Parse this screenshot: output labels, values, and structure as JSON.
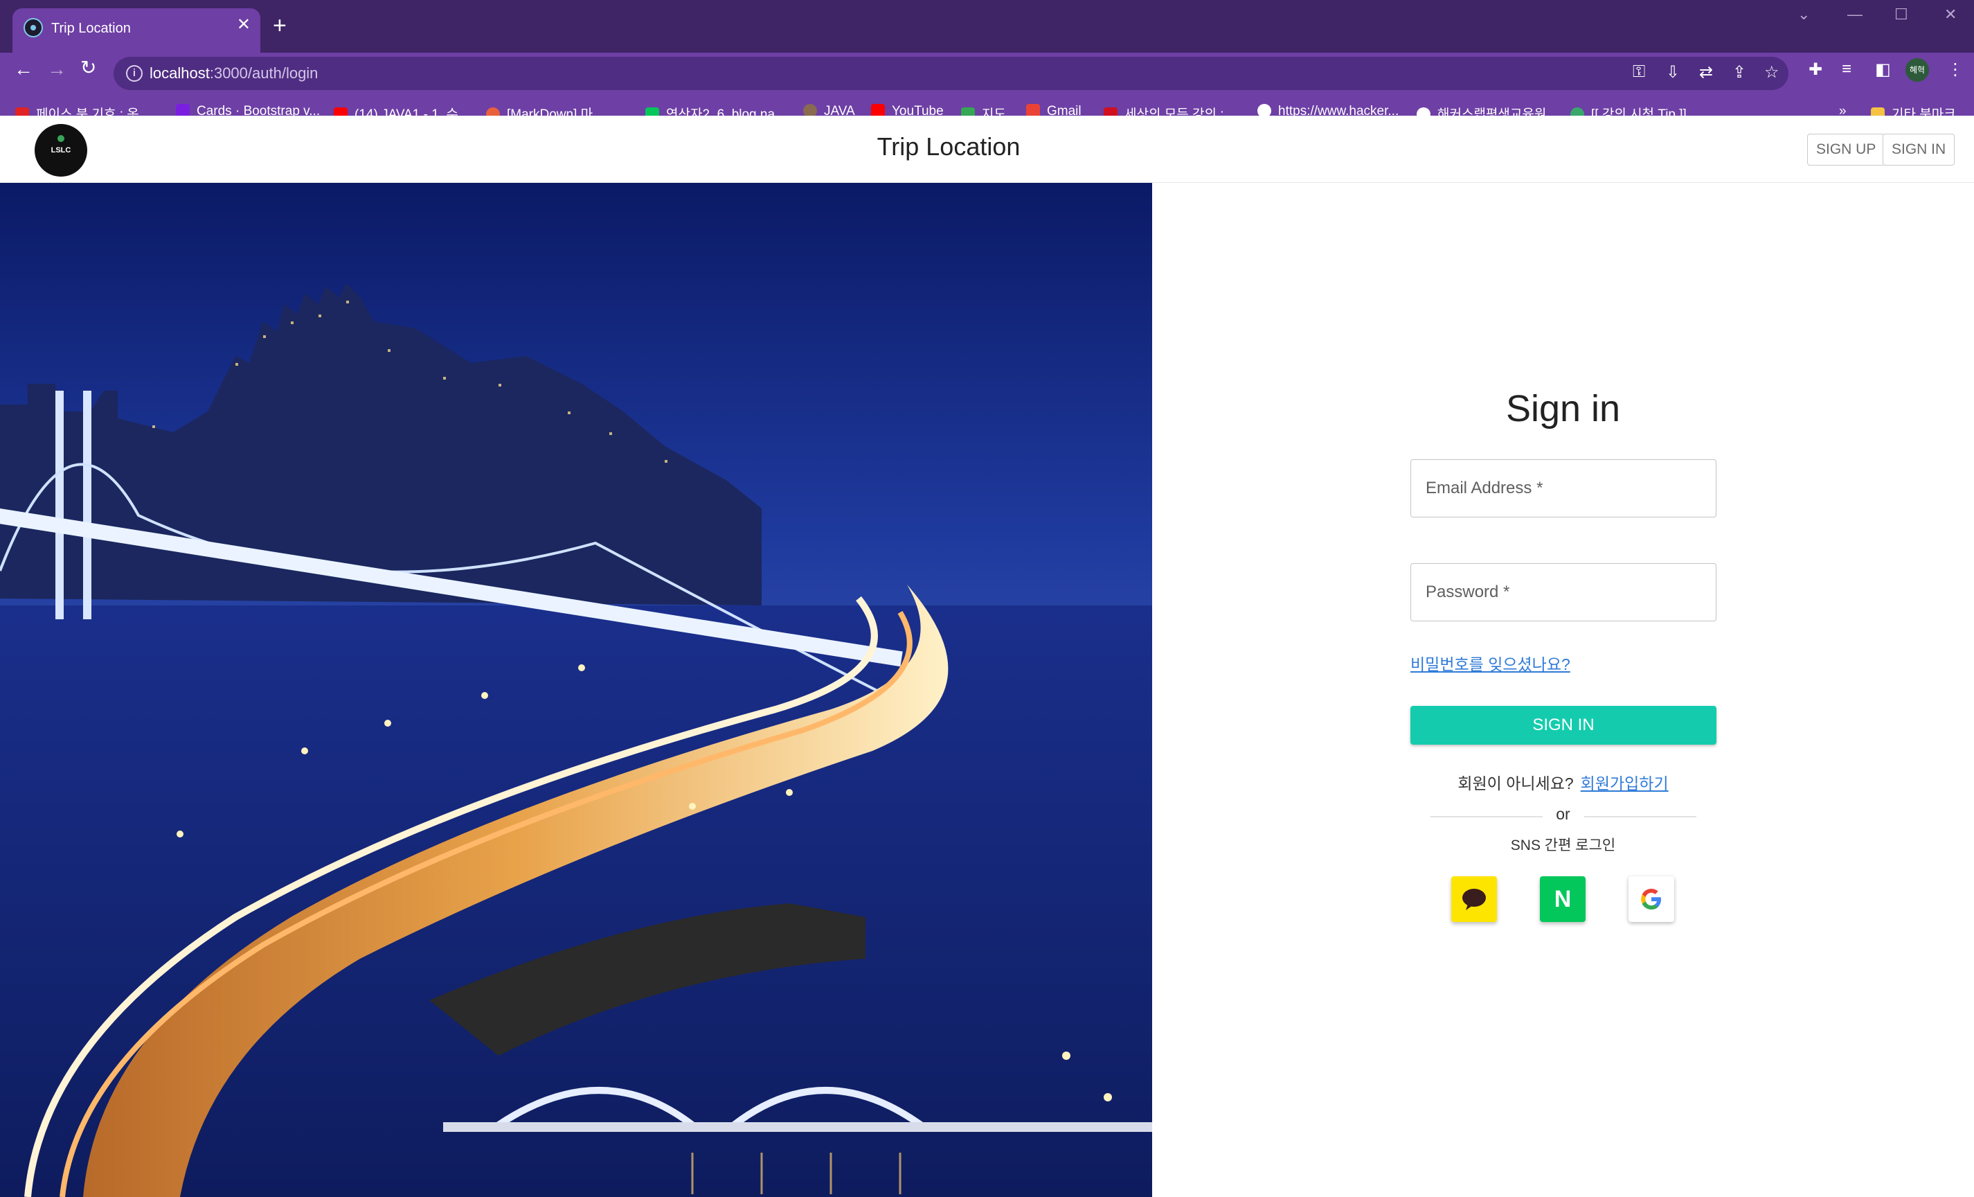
{
  "browser": {
    "tab_title": "Trip Location",
    "tab_close": "✕",
    "new_tab": "+",
    "url_host": "localhost",
    "url_path": ":3000/auth/login",
    "profile_label": "혜혁",
    "bookmarks": [
      "페이스 북 기호 : 옷...",
      "Cards · Bootstrap v...",
      "(14) JAVA1 - 1. 수...",
      "[MarkDown] 마...",
      "연산자2_6, blog.na...",
      "JAVA",
      "YouTube",
      "지도",
      "Gmail",
      "세상의 모든 강의 :...",
      "https://www.hacker...",
      "해커스랩평생교육원",
      "[[ 강의 시청 Tip ]]..."
    ],
    "bookmarks_overflow": "»",
    "other_bookmarks": "기타 북마크"
  },
  "app": {
    "logo_text": "LSLC",
    "title": "Trip Location",
    "signup_button": "SIGN UP",
    "signin_nav_button": "SIGN IN"
  },
  "login": {
    "heading": "Sign in",
    "email_label": "Email Address *",
    "password_label": "Password *",
    "forgot_link": "비밀번호를 잊으셨나요?",
    "submit": "SIGN IN",
    "not_member": "회원이 아니세요?",
    "register_link": "회원가입하기",
    "or": "or",
    "sns_label": "SNS 간편 로그인",
    "naver_letter": "N"
  },
  "colors": {
    "tabstrip": "#3f2466",
    "toolbar": "#6e3fa5",
    "accent": "#14ccad",
    "link": "#2f7bd8",
    "kakao": "#fee500",
    "naver": "#03c75a"
  }
}
